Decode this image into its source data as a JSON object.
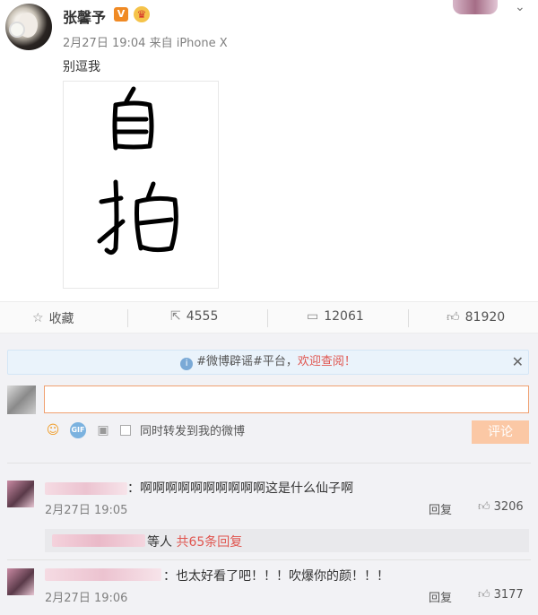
{
  "post": {
    "author_name": "张馨予",
    "badge_v": "V",
    "badge_crown": "♛",
    "date": "2月27日",
    "time": "19:04",
    "source": "来自 iPhone X",
    "text": "别逗我",
    "image_text_line1": "自",
    "image_text_line2": "拍"
  },
  "actions": {
    "favorite_label": "收藏",
    "repost_count": "4555",
    "comment_count": "12061",
    "like_count": "81920"
  },
  "notice": {
    "hashtag1": "#微博辟谣#",
    "text_mid": "平台，",
    "accent_text": "欢迎查阅！"
  },
  "composer": {
    "input_value": "",
    "input_placeholder": "",
    "sync_label": "同时转发到我的微博",
    "submit_label": "评论"
  },
  "comments": [
    {
      "text": "：啊啊啊啊啊啊啊啊啊啊这是什么仙子啊",
      "date": "2月27日",
      "time": "19:05",
      "reply_label": "回复",
      "likes": "3206"
    },
    {
      "text": "：也太好看了吧！！！吹爆你的颜！！！",
      "date": "2月27日",
      "time": "19:06",
      "reply_label": "回复",
      "likes": "3177"
    }
  ],
  "sub_reply": {
    "text": "等人",
    "count_text": "共65条回复"
  },
  "colors": {
    "accent_orange": "#f08a24",
    "input_border": "#f0a070",
    "submit_bg": "#fbc8a5",
    "link_red": "#e0554f",
    "notice_bg": "#eaf3fb"
  }
}
